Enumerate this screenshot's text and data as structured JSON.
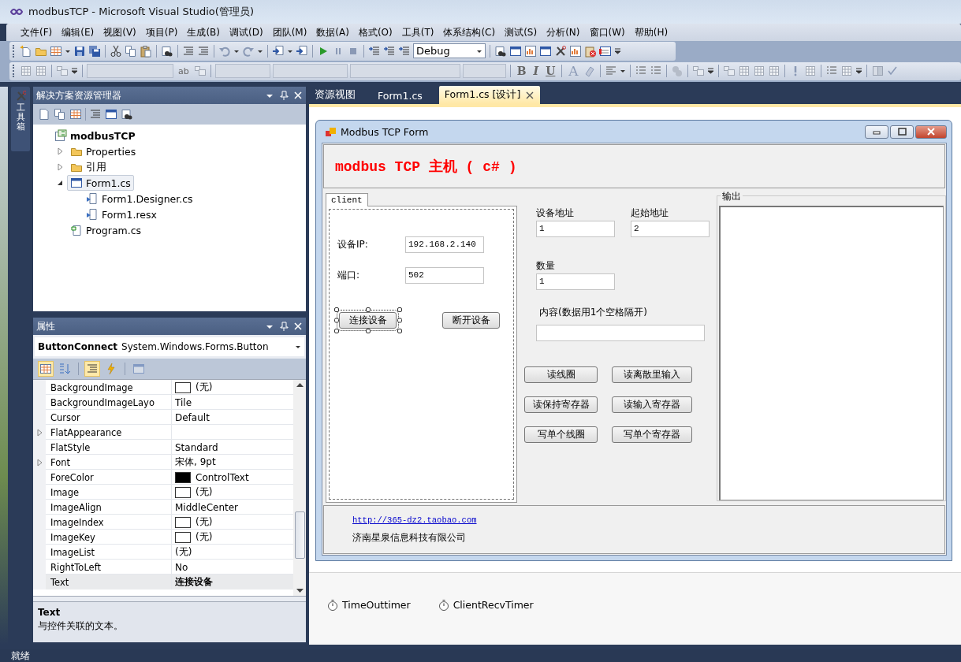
{
  "window": {
    "title": "modbusTCP - Microsoft Visual Studio(管理员)"
  },
  "menu": [
    "文件(F)",
    "编辑(E)",
    "视图(V)",
    "项目(P)",
    "生成(B)",
    "调试(D)",
    "团队(M)",
    "数据(A)",
    "格式(O)",
    "工具(T)",
    "体系结构(C)",
    "测试(S)",
    "分析(N)",
    "窗口(W)",
    "帮助(H)"
  ],
  "toolbar": {
    "configuration": "Debug",
    "text_glyphs": [
      "ab",
      "B",
      "I",
      "U",
      "A"
    ]
  },
  "toolbox": {
    "label": "工具箱"
  },
  "solution_explorer": {
    "title": "解决方案资源管理器",
    "tree": [
      {
        "label": "modbusTCP",
        "kind": "project",
        "selected": false,
        "children": [
          {
            "label": "Properties",
            "kind": "properties",
            "expanded": false,
            "selected": false
          },
          {
            "label": "引用",
            "kind": "references",
            "expanded": false,
            "selected": false
          },
          {
            "label": "Form1.cs",
            "kind": "form",
            "expanded": true,
            "selected": true,
            "children": [
              {
                "label": "Form1.Designer.cs",
                "kind": "dependent",
                "selected": false
              },
              {
                "label": "Form1.resx",
                "kind": "dependent",
                "selected": false
              }
            ]
          },
          {
            "label": "Program.cs",
            "kind": "csharp",
            "selected": false
          }
        ]
      }
    ]
  },
  "properties": {
    "title": "属性",
    "object_name": "ButtonConnect",
    "object_type": "System.Windows.Forms.Button",
    "view_buttons": [
      {
        "kind": "categorized",
        "selected": true,
        "disabled": false
      },
      {
        "kind": "alphabetical",
        "selected": false,
        "disabled": false
      },
      {
        "kind": "properties",
        "selected": true,
        "disabled": false
      },
      {
        "kind": "events",
        "selected": false,
        "disabled": false
      },
      {
        "kind": "property-pages",
        "selected": false,
        "disabled": true
      }
    ],
    "rows": [
      {
        "name": "BackgroundImage",
        "value": "(无)",
        "kind": "swatch",
        "selected": false
      },
      {
        "name": "BackgroundImageLayo",
        "value": "Tile",
        "kind": "plain",
        "selected": false
      },
      {
        "name": "Cursor",
        "value": "Default",
        "kind": "plain",
        "selected": false
      },
      {
        "name": "FlatAppearance",
        "value": "",
        "kind": "plain",
        "expanded": false,
        "selected": false
      },
      {
        "name": "FlatStyle",
        "value": "Standard",
        "kind": "plain",
        "selected": false
      },
      {
        "name": "Font",
        "value": "宋体, 9pt",
        "kind": "plain",
        "expanded": false,
        "selected": false
      },
      {
        "name": "ForeColor",
        "value": "ControlText",
        "kind": "color-swatch",
        "color": "#000000",
        "selected": false
      },
      {
        "name": "Image",
        "value": "(无)",
        "kind": "swatch",
        "selected": false
      },
      {
        "name": "ImageAlign",
        "value": "MiddleCenter",
        "kind": "plain",
        "selected": false
      },
      {
        "name": "ImageIndex",
        "value": "(无)",
        "kind": "swatch",
        "selected": false
      },
      {
        "name": "ImageKey",
        "value": "(无)",
        "kind": "swatch",
        "selected": false
      },
      {
        "name": "ImageList",
        "value": "(无)",
        "kind": "plain",
        "selected": false
      },
      {
        "name": "RightToLeft",
        "value": "No",
        "kind": "plain",
        "selected": false
      },
      {
        "name": "Text",
        "value": "连接设备",
        "kind": "plain",
        "selected": true
      }
    ],
    "description": {
      "title": "Text",
      "text": "与控件关联的文本。"
    }
  },
  "document_tabs": [
    {
      "label": "资源视图",
      "selected": false
    },
    {
      "label": "Form1.cs",
      "selected": false
    },
    {
      "label": "Form1.cs [设计]",
      "selected": true
    }
  ],
  "form": {
    "title": "Modbus TCP Form",
    "heading": "modbus TCP 主机 ( c# )",
    "tab": {
      "label": "client",
      "selected": true
    },
    "client": {
      "ip_label": "设备IP:",
      "ip_value": "192.168.2.140",
      "port_label": "端口:",
      "port_value": "502",
      "buttons": [
        {
          "label": "连接设备",
          "selected": true
        },
        {
          "label": "断开设备",
          "selected": false
        }
      ]
    },
    "fields": [
      {
        "label": "设备地址",
        "value": "1"
      },
      {
        "label": "起始地址",
        "value": "2"
      },
      {
        "label": "数量",
        "value": "1"
      }
    ],
    "content": {
      "label": "内容(数据用1个空格隔开)"
    },
    "actions": [
      "读线圈",
      "读离散里输入",
      "读保持寄存器",
      "读输入寄存器",
      "写单个线圈",
      "写单个寄存器"
    ],
    "output": {
      "label": "输出"
    },
    "footer": {
      "link": "http://365-dz2.taobao.com",
      "company": "济南星泉信息科技有限公司"
    }
  },
  "component_tray": [
    "TimeOuttimer",
    "ClientRecvTimer"
  ],
  "status_bar": {
    "text": "就绪"
  }
}
